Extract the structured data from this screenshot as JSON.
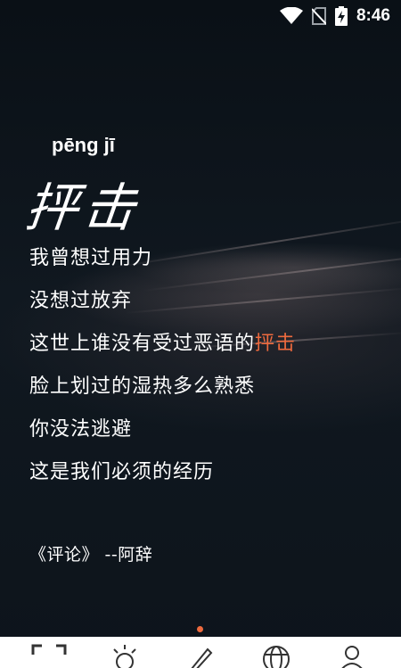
{
  "status_bar": {
    "time": "8:46",
    "icons": [
      "wifi-icon",
      "no-sim-icon",
      "battery-charging-icon"
    ]
  },
  "content": {
    "pinyin": "pēng jī",
    "title": "抨击",
    "lyrics": [
      {
        "text": "我曾想过用力",
        "highlight": ""
      },
      {
        "text": "没想过放弃",
        "highlight": ""
      },
      {
        "text": "这世上谁没有受过恶语的",
        "highlight": "抨击"
      },
      {
        "text": "脸上划过的湿热多么熟悉",
        "highlight": ""
      },
      {
        "text": "你没法逃避",
        "highlight": ""
      },
      {
        "text": "这是我们必须的经历",
        "highlight": ""
      }
    ],
    "source": "《评论》 --阿辞"
  },
  "pager": {
    "active_index": 0,
    "count": 1
  },
  "bottom_nav": {
    "items": [
      {
        "icon": "scan-frame-icon"
      },
      {
        "icon": "sun-icon"
      },
      {
        "icon": "pencil-icon"
      },
      {
        "icon": "globe-icon"
      },
      {
        "icon": "user-icon"
      }
    ]
  },
  "colors": {
    "background": "#0e151c",
    "text": "#ffffff",
    "accent": "#ee6a3e",
    "nav_background": "#ffffff",
    "nav_icon": "#333333"
  }
}
